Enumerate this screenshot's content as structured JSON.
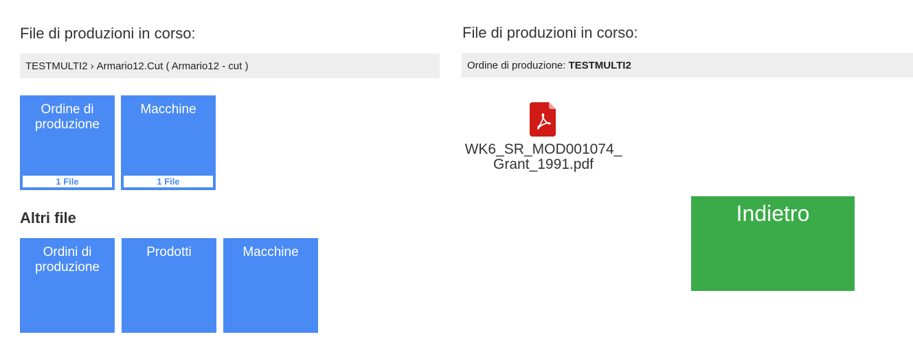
{
  "left_panel": {
    "title": "File di produzioni in corso:",
    "breadcrumb": {
      "order": "TESTMULTI2",
      "separator": "›",
      "item": "Armario12.Cut ( Armario12 - cut )"
    },
    "current_tiles": [
      {
        "label": "Ordine di produzione",
        "count": "1 File"
      },
      {
        "label": "Macchine",
        "count": "1 File"
      }
    ],
    "other_files_heading": "Altri file",
    "other_tiles": [
      {
        "label": "Ordini di produzione"
      },
      {
        "label": "Prodotti"
      },
      {
        "label": "Macchine"
      }
    ]
  },
  "right_panel": {
    "title": "File di produzioni in corso:",
    "breadcrumb": {
      "prefix": "Ordine di produzione:",
      "order": "TESTMULTI2"
    },
    "files": [
      {
        "name": "WK6_SR_MOD001074_Grant_1991.pdf",
        "icon": "pdf-file-icon"
      }
    ],
    "back_button": "Indietro"
  },
  "colors": {
    "tile_blue": "#4a8af4",
    "back_green": "#3aab48",
    "pdf_red": "#d01b16",
    "bar_gray": "#eeeeee"
  }
}
